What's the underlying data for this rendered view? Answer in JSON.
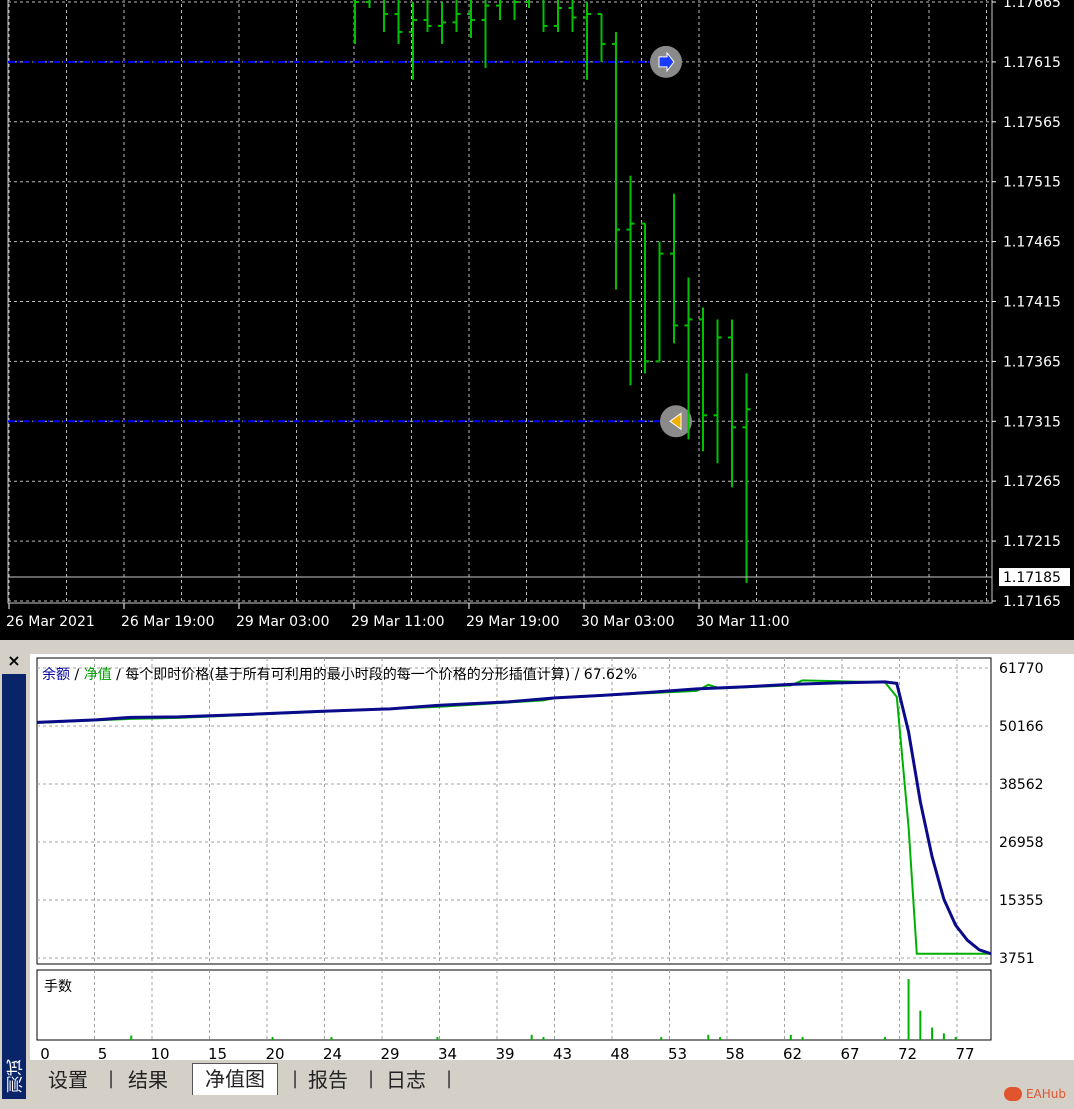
{
  "chart_data": [
    {
      "type": "bar",
      "bar_style": "OHLC",
      "symbol": "EURUSD",
      "colors": {
        "background": "#000000",
        "bars": "#00c000",
        "grid": "#c8c8c8",
        "trade_line": "#0000ff",
        "axis_text": "#ffffff"
      },
      "ylim": [
        1.17165,
        1.17665
      ],
      "y_ticks": [
        "1.17665",
        "1.17615",
        "1.17565",
        "1.17515",
        "1.17465",
        "1.17415",
        "1.17365",
        "1.17315",
        "1.17265",
        "1.17215",
        "1.17165"
      ],
      "x_ticks": [
        "26 Mar 2021",
        "26 Mar 19:00",
        "29 Mar 03:00",
        "29 Mar 11:00",
        "29 Mar 19:00",
        "30 Mar 03:00",
        "30 Mar 11:00"
      ],
      "current_price": "1.17185",
      "grid": true,
      "trade_lines": [
        {
          "price": 1.17615,
          "marker": "arrow-right"
        },
        {
          "price": 1.17315,
          "marker": "arrow-left"
        }
      ],
      "bars": [
        {
          "o": 1.1767,
          "h": 1.1769,
          "l": 1.1763,
          "c": 1.17665
        },
        {
          "o": 1.17665,
          "h": 1.1768,
          "l": 1.1766,
          "c": 1.17668
        },
        {
          "o": 1.17668,
          "h": 1.17685,
          "l": 1.1764,
          "c": 1.17655
        },
        {
          "o": 1.17655,
          "h": 1.1767,
          "l": 1.1763,
          "c": 1.1764
        },
        {
          "o": 1.1764,
          "h": 1.17665,
          "l": 1.176,
          "c": 1.1765
        },
        {
          "o": 1.1765,
          "h": 1.1768,
          "l": 1.1764,
          "c": 1.17645
        },
        {
          "o": 1.17645,
          "h": 1.17665,
          "l": 1.1763,
          "c": 1.17648
        },
        {
          "o": 1.17648,
          "h": 1.1767,
          "l": 1.1764,
          "c": 1.17655
        },
        {
          "o": 1.17655,
          "h": 1.17675,
          "l": 1.17635,
          "c": 1.1765
        },
        {
          "o": 1.1765,
          "h": 1.1768,
          "l": 1.1761,
          "c": 1.17662
        },
        {
          "o": 1.17662,
          "h": 1.17678,
          "l": 1.1765,
          "c": 1.1767
        },
        {
          "o": 1.1767,
          "h": 1.1769,
          "l": 1.1765,
          "c": 1.17665
        },
        {
          "o": 1.17665,
          "h": 1.17685,
          "l": 1.1766,
          "c": 1.1767
        },
        {
          "o": 1.1767,
          "h": 1.17685,
          "l": 1.1764,
          "c": 1.17645
        },
        {
          "o": 1.17645,
          "h": 1.1767,
          "l": 1.1764,
          "c": 1.1766
        },
        {
          "o": 1.1766,
          "h": 1.1768,
          "l": 1.1764,
          "c": 1.17652
        },
        {
          "o": 1.17652,
          "h": 1.17665,
          "l": 1.176,
          "c": 1.17655
        },
        {
          "o": 1.17655,
          "h": 1.17655,
          "l": 1.17615,
          "c": 1.1763
        },
        {
          "o": 1.1763,
          "h": 1.1764,
          "l": 1.17425,
          "c": 1.17475
        },
        {
          "o": 1.17475,
          "h": 1.1752,
          "l": 1.17345,
          "c": 1.1748
        },
        {
          "o": 1.1748,
          "h": 1.1748,
          "l": 1.17355,
          "c": 1.17365
        },
        {
          "o": 1.17365,
          "h": 1.17465,
          "l": 1.17365,
          "c": 1.17455
        },
        {
          "o": 1.17455,
          "h": 1.17505,
          "l": 1.1738,
          "c": 1.17395
        },
        {
          "o": 1.17395,
          "h": 1.17435,
          "l": 1.173,
          "c": 1.174
        },
        {
          "o": 1.174,
          "h": 1.1741,
          "l": 1.1729,
          "c": 1.1732
        },
        {
          "o": 1.1732,
          "h": 1.174,
          "l": 1.1728,
          "c": 1.17385
        },
        {
          "o": 1.17385,
          "h": 1.174,
          "l": 1.1726,
          "c": 1.1731
        },
        {
          "o": 1.1731,
          "h": 1.17355,
          "l": 1.1718,
          "c": 1.17325
        }
      ]
    },
    {
      "type": "line",
      "title_parts": [
        {
          "text": "余额",
          "color": "#0000a0"
        },
        {
          "text": " / ",
          "color": "#000000"
        },
        {
          "text": "净值",
          "color": "#00a000"
        },
        {
          "text": " / 每个即时价格(基于所有可利用的最小时段的每一个价格的分形插值计算) / 67.62%",
          "color": "#000000"
        }
      ],
      "ylim": [
        3751,
        61770
      ],
      "y_ticks": [
        "61770",
        "50166",
        "38562",
        "26958",
        "15355",
        "3751"
      ],
      "x_ticks": [
        "0",
        "5",
        "10",
        "15",
        "20",
        "24",
        "29",
        "34",
        "39",
        "43",
        "48",
        "53",
        "58",
        "62",
        "67",
        "72",
        "77"
      ],
      "xlim": [
        0,
        81
      ],
      "grid": true,
      "series": [
        {
          "name": "余额",
          "color": "#0a0a8a",
          "x": [
            0,
            5,
            8,
            12,
            18,
            24,
            30,
            34,
            40,
            44,
            48,
            52,
            56,
            60,
            64,
            68,
            72,
            73,
            74,
            75,
            76,
            77,
            78,
            79,
            80,
            81
          ],
          "y": [
            50900,
            51400,
            51900,
            52000,
            52500,
            53100,
            53600,
            54300,
            55000,
            55800,
            56300,
            56900,
            57600,
            58000,
            58500,
            58800,
            59000,
            58700,
            49000,
            35000,
            24000,
            15500,
            10300,
            7300,
            5400,
            4600
          ]
        },
        {
          "name": "净值",
          "color": "#00b000",
          "x": [
            0,
            8,
            12,
            24,
            34,
            43,
            44,
            56,
            57,
            58,
            64,
            65,
            72,
            73,
            74,
            74.7,
            81
          ],
          "y": [
            50800,
            51600,
            51800,
            53000,
            54000,
            55300,
            55800,
            57200,
            58400,
            57700,
            58300,
            59300,
            58900,
            56000,
            30000,
            4600,
            4600
          ]
        }
      ]
    },
    {
      "type": "bar",
      "title": "手数",
      "colors": {
        "bars": "#00b000"
      },
      "x": [
        8,
        20,
        25,
        34,
        42,
        43,
        53,
        57,
        58,
        64,
        65,
        72,
        74,
        75,
        76,
        77,
        78
      ],
      "values": [
        0.6,
        0.4,
        0.4,
        0.4,
        0.7,
        0.4,
        0.4,
        0.7,
        0.4,
        0.7,
        0.4,
        0.4,
        8.3,
        4.0,
        1.7,
        0.9,
        0.4
      ],
      "ylim": [
        0,
        9
      ],
      "xlim": [
        0,
        81
      ]
    }
  ],
  "panel": {
    "close_label": "×",
    "side_label": "测试"
  },
  "tabs": [
    {
      "label": "设置"
    },
    {
      "label": "结果"
    },
    {
      "label": "净值图",
      "active": true
    },
    {
      "label": "报告"
    },
    {
      "label": "日志"
    }
  ],
  "watermark": "EAHub"
}
